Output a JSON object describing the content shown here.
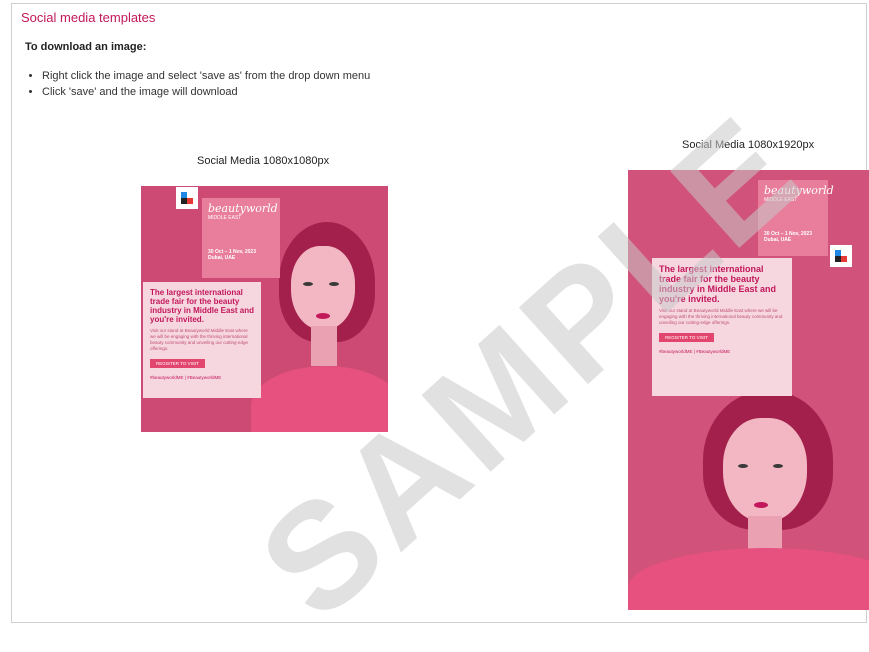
{
  "page": {
    "title": "Social media templates"
  },
  "instructions": {
    "heading": "To download an image:",
    "steps": [
      "Right click the image and select 'save as' from the drop down menu",
      "Click 'save' and the image will download"
    ]
  },
  "templates": [
    {
      "caption": "Social Media 1080x1080px",
      "brand": "beautyworld",
      "region": "MIDDLE EAST",
      "date": "30 Oct – 1 Nov, 2023",
      "location": "Dubai, UAE",
      "headline": "The largest international trade fair for the beauty industry in Middle East and you're invited.",
      "body": "Visit our stand at Beautyworld Middle East where we will be engaging with the thriving international beauty community and unveiling our cutting-edge offerings.",
      "button": "REGISTER TO VISIT",
      "tags": "#beautyworldME | #BeautyworldME"
    },
    {
      "caption": "Social Media 1080x1920px",
      "brand": "beautyworld",
      "region": "MIDDLE EAST",
      "date": "30 Oct – 1 Nov, 2023",
      "location": "Dubai, UAE",
      "headline": "The largest international trade fair for the beauty industry in Middle East and you're invited.",
      "body": "Visit our stand at Beautyworld Middle East where we will be engaging with the thriving international beauty community and unveiling our cutting-edge offerings.",
      "button": "REGISTER TO VISIT",
      "tags": "#beautyworldME | #BeautyworldME"
    }
  ],
  "watermark": "SAMPLE",
  "colors": {
    "accent": "#c2185b",
    "template_bg": "#cc4a74"
  }
}
